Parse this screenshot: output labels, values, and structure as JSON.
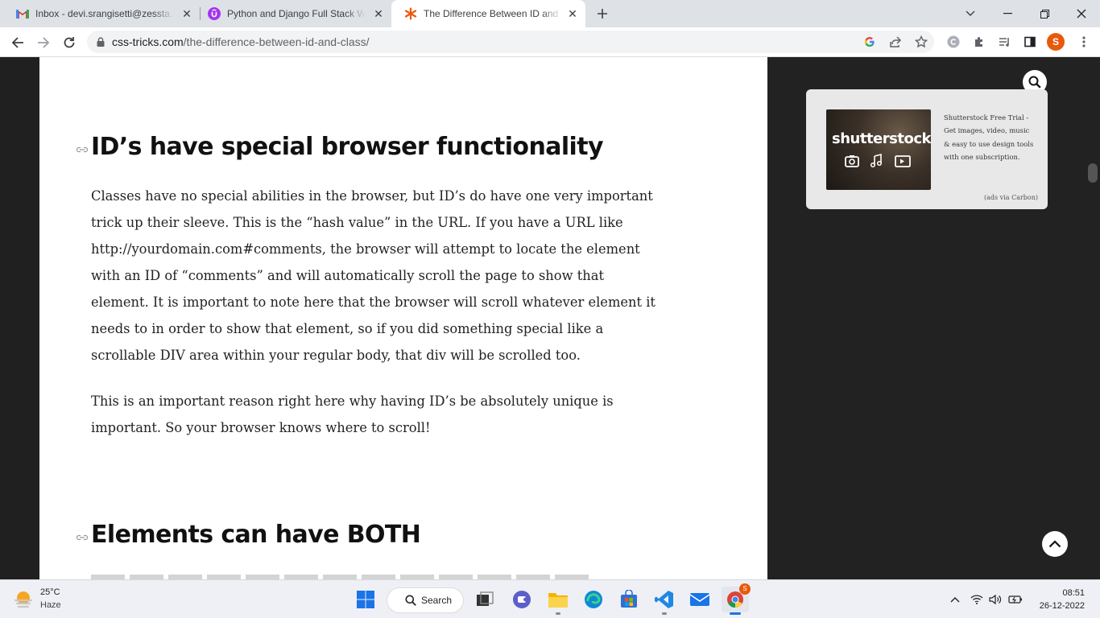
{
  "browser": {
    "tabs": [
      {
        "title": "Inbox - devi.srangisetti@zessta.com",
        "icon": "gmail-icon"
      },
      {
        "title": "Python and Django Full Stack Web Developer",
        "icon": "udemy-icon"
      },
      {
        "title": "The Difference Between ID and Class",
        "icon": "css-tricks-icon",
        "active": true
      }
    ],
    "url_host": "css-tricks.com",
    "url_path": "/the-difference-between-id-and-class/",
    "profile_initial": "S"
  },
  "article": {
    "heading1": "ID’s have special browser functionality",
    "para1": "Classes have no special abilities in the browser, but ID’s do have one very important trick up their sleeve. This is the “hash value” in the URL. If you have a URL like http://yourdomain.com#comments, the browser will attempt to locate the element with an ID of “comments” and will automatically scroll the page to show that element. It is important to note here that the browser will scroll whatever element it needs to in order to show that element, so if you did something special like a scrollable DIV area within your regular body, that div will be scrolled too.",
    "para2": "This is an important reason right here why having ID’s be absolutely unique is important. So your browser knows where to scroll!",
    "heading2": "Elements can have BOTH"
  },
  "ad": {
    "logo_text": "shutterstock",
    "text": "Shutterstock Free Trial - Get images, video, music & easy to use design tools with one subscription.",
    "via": "(ads via Carbon)"
  },
  "taskbar": {
    "weather_temp": "25°C",
    "weather_cond": "Haze",
    "search_label": "Search",
    "time": "08:51",
    "date": "26-12-2022",
    "chrome_badge": "S"
  },
  "colors": {
    "accent": "#e8590c",
    "page_bg": "#202020"
  }
}
